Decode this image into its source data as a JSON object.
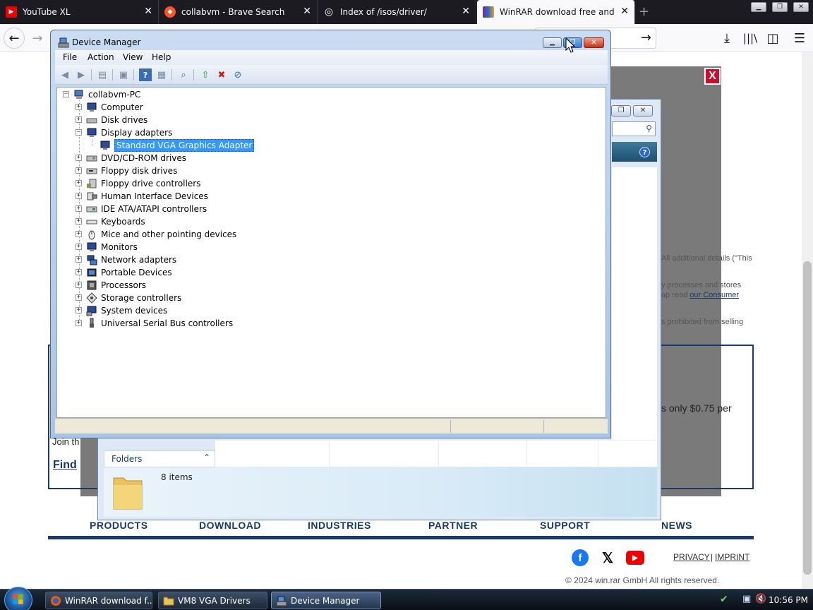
{
  "browser": {
    "tabs": [
      {
        "label": "YouTube XL",
        "icon": "youtube-icon",
        "active": false
      },
      {
        "label": "collabvm - Brave Search",
        "icon": "brave-icon",
        "active": false
      },
      {
        "label": "Index of /isos/driver/",
        "icon": "globe-icon",
        "active": false
      },
      {
        "label": "WinRAR download free and sup",
        "icon": "winrar-icon",
        "active": true
      }
    ]
  },
  "page": {
    "fragments": {
      "details": "All additional details (\"This",
      "processes": "y processes and stores",
      "read": "ap read",
      "consumer_link": "our Consumer",
      "selling": "s prohibited from selling"
    },
    "price_text": "s only $0.75 per",
    "join_text": "Join th",
    "find_link": "Find",
    "close_label": "X",
    "footer_nav": [
      "PRODUCTS",
      "DOWNLOAD",
      "INDUSTRIES",
      "PARTNER",
      "SUPPORT",
      "NEWS"
    ],
    "footer_links": {
      "privacy": "PRIVACY",
      "separator": "|",
      "imprint": "IMPRINT"
    },
    "copyright": "© 2024 win.rar GmbH All rights reserved.",
    "social_icons": [
      "facebook-icon",
      "x-icon",
      "youtube-icon"
    ]
  },
  "explorer": {
    "folders_label": "Folders",
    "item_count": "8 items",
    "help_label": "?"
  },
  "device_manager": {
    "title": "Device Manager",
    "menu": [
      "File",
      "Action",
      "View",
      "Help"
    ],
    "tree": {
      "root": "collabvm-PC",
      "nodes": [
        {
          "label": "Computer",
          "icon": "computer-icon",
          "expanded": false
        },
        {
          "label": "Disk drives",
          "icon": "disk-drive-icon",
          "expanded": false
        },
        {
          "label": "Display adapters",
          "icon": "display-adapter-icon",
          "expanded": true,
          "children": [
            {
              "label": "Standard VGA Graphics Adapter",
              "icon": "monitor-icon",
              "selected": true
            }
          ]
        },
        {
          "label": "DVD/CD-ROM drives",
          "icon": "dvd-drive-icon",
          "expanded": false
        },
        {
          "label": "Floppy disk drives",
          "icon": "floppy-disk-icon",
          "expanded": false
        },
        {
          "label": "Floppy drive controllers",
          "icon": "floppy-controller-icon",
          "expanded": false
        },
        {
          "label": "Human Interface Devices",
          "icon": "hid-icon",
          "expanded": false
        },
        {
          "label": "IDE ATA/ATAPI controllers",
          "icon": "ide-controller-icon",
          "expanded": false
        },
        {
          "label": "Keyboards",
          "icon": "keyboard-icon",
          "expanded": false
        },
        {
          "label": "Mice and other pointing devices",
          "icon": "mouse-icon",
          "expanded": false
        },
        {
          "label": "Monitors",
          "icon": "monitor-icon",
          "expanded": false
        },
        {
          "label": "Network adapters",
          "icon": "network-adapter-icon",
          "expanded": false
        },
        {
          "label": "Portable Devices",
          "icon": "portable-device-icon",
          "expanded": false
        },
        {
          "label": "Processors",
          "icon": "processor-icon",
          "expanded": false
        },
        {
          "label": "Storage controllers",
          "icon": "storage-controller-icon",
          "expanded": false
        },
        {
          "label": "System devices",
          "icon": "system-devices-icon",
          "expanded": false
        },
        {
          "label": "Universal Serial Bus controllers",
          "icon": "usb-icon",
          "expanded": false
        }
      ]
    }
  },
  "taskbar": {
    "tasks": [
      {
        "label": "WinRAR download f...",
        "icon": "firefox-icon",
        "active": false
      },
      {
        "label": "VM8 VGA Drivers",
        "icon": "folder-icon",
        "active": false
      },
      {
        "label": "Device Manager",
        "icon": "device-manager-icon",
        "active": true
      }
    ],
    "clock": "10:56 PM"
  },
  "colors": {
    "accent_blue": "#1b3a6b",
    "selection": "#3399ff",
    "close_red": "#c8102e"
  }
}
